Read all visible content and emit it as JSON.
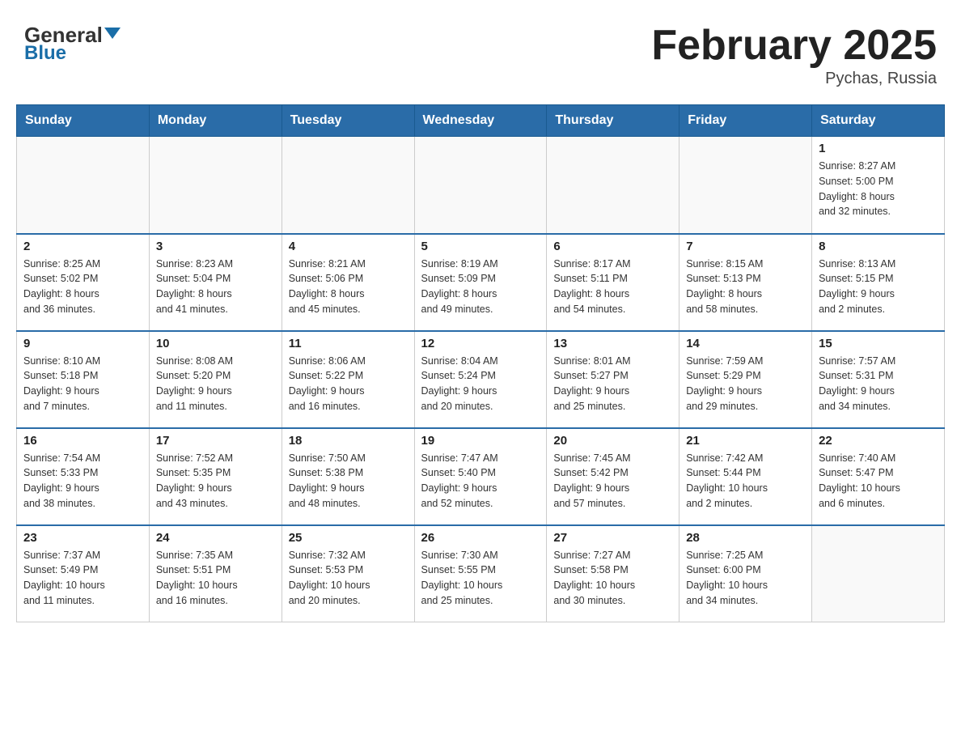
{
  "header": {
    "logo_general": "General",
    "logo_blue": "Blue",
    "month_title": "February 2025",
    "location": "Pychas, Russia"
  },
  "weekdays": [
    "Sunday",
    "Monday",
    "Tuesday",
    "Wednesday",
    "Thursday",
    "Friday",
    "Saturday"
  ],
  "weeks": [
    [
      {
        "day": "",
        "info": ""
      },
      {
        "day": "",
        "info": ""
      },
      {
        "day": "",
        "info": ""
      },
      {
        "day": "",
        "info": ""
      },
      {
        "day": "",
        "info": ""
      },
      {
        "day": "",
        "info": ""
      },
      {
        "day": "1",
        "info": "Sunrise: 8:27 AM\nSunset: 5:00 PM\nDaylight: 8 hours\nand 32 minutes."
      }
    ],
    [
      {
        "day": "2",
        "info": "Sunrise: 8:25 AM\nSunset: 5:02 PM\nDaylight: 8 hours\nand 36 minutes."
      },
      {
        "day": "3",
        "info": "Sunrise: 8:23 AM\nSunset: 5:04 PM\nDaylight: 8 hours\nand 41 minutes."
      },
      {
        "day": "4",
        "info": "Sunrise: 8:21 AM\nSunset: 5:06 PM\nDaylight: 8 hours\nand 45 minutes."
      },
      {
        "day": "5",
        "info": "Sunrise: 8:19 AM\nSunset: 5:09 PM\nDaylight: 8 hours\nand 49 minutes."
      },
      {
        "day": "6",
        "info": "Sunrise: 8:17 AM\nSunset: 5:11 PM\nDaylight: 8 hours\nand 54 minutes."
      },
      {
        "day": "7",
        "info": "Sunrise: 8:15 AM\nSunset: 5:13 PM\nDaylight: 8 hours\nand 58 minutes."
      },
      {
        "day": "8",
        "info": "Sunrise: 8:13 AM\nSunset: 5:15 PM\nDaylight: 9 hours\nand 2 minutes."
      }
    ],
    [
      {
        "day": "9",
        "info": "Sunrise: 8:10 AM\nSunset: 5:18 PM\nDaylight: 9 hours\nand 7 minutes."
      },
      {
        "day": "10",
        "info": "Sunrise: 8:08 AM\nSunset: 5:20 PM\nDaylight: 9 hours\nand 11 minutes."
      },
      {
        "day": "11",
        "info": "Sunrise: 8:06 AM\nSunset: 5:22 PM\nDaylight: 9 hours\nand 16 minutes."
      },
      {
        "day": "12",
        "info": "Sunrise: 8:04 AM\nSunset: 5:24 PM\nDaylight: 9 hours\nand 20 minutes."
      },
      {
        "day": "13",
        "info": "Sunrise: 8:01 AM\nSunset: 5:27 PM\nDaylight: 9 hours\nand 25 minutes."
      },
      {
        "day": "14",
        "info": "Sunrise: 7:59 AM\nSunset: 5:29 PM\nDaylight: 9 hours\nand 29 minutes."
      },
      {
        "day": "15",
        "info": "Sunrise: 7:57 AM\nSunset: 5:31 PM\nDaylight: 9 hours\nand 34 minutes."
      }
    ],
    [
      {
        "day": "16",
        "info": "Sunrise: 7:54 AM\nSunset: 5:33 PM\nDaylight: 9 hours\nand 38 minutes."
      },
      {
        "day": "17",
        "info": "Sunrise: 7:52 AM\nSunset: 5:35 PM\nDaylight: 9 hours\nand 43 minutes."
      },
      {
        "day": "18",
        "info": "Sunrise: 7:50 AM\nSunset: 5:38 PM\nDaylight: 9 hours\nand 48 minutes."
      },
      {
        "day": "19",
        "info": "Sunrise: 7:47 AM\nSunset: 5:40 PM\nDaylight: 9 hours\nand 52 minutes."
      },
      {
        "day": "20",
        "info": "Sunrise: 7:45 AM\nSunset: 5:42 PM\nDaylight: 9 hours\nand 57 minutes."
      },
      {
        "day": "21",
        "info": "Sunrise: 7:42 AM\nSunset: 5:44 PM\nDaylight: 10 hours\nand 2 minutes."
      },
      {
        "day": "22",
        "info": "Sunrise: 7:40 AM\nSunset: 5:47 PM\nDaylight: 10 hours\nand 6 minutes."
      }
    ],
    [
      {
        "day": "23",
        "info": "Sunrise: 7:37 AM\nSunset: 5:49 PM\nDaylight: 10 hours\nand 11 minutes."
      },
      {
        "day": "24",
        "info": "Sunrise: 7:35 AM\nSunset: 5:51 PM\nDaylight: 10 hours\nand 16 minutes."
      },
      {
        "day": "25",
        "info": "Sunrise: 7:32 AM\nSunset: 5:53 PM\nDaylight: 10 hours\nand 20 minutes."
      },
      {
        "day": "26",
        "info": "Sunrise: 7:30 AM\nSunset: 5:55 PM\nDaylight: 10 hours\nand 25 minutes."
      },
      {
        "day": "27",
        "info": "Sunrise: 7:27 AM\nSunset: 5:58 PM\nDaylight: 10 hours\nand 30 minutes."
      },
      {
        "day": "28",
        "info": "Sunrise: 7:25 AM\nSunset: 6:00 PM\nDaylight: 10 hours\nand 34 minutes."
      },
      {
        "day": "",
        "info": ""
      }
    ]
  ]
}
